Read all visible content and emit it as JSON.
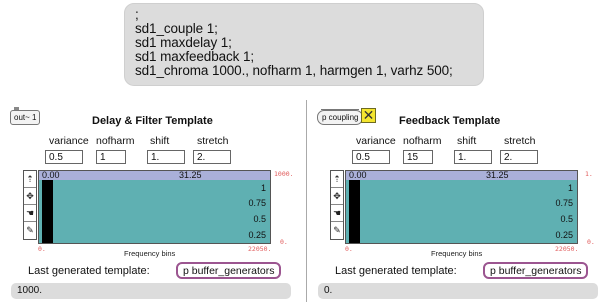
{
  "message_box": {
    "lines": [
      ";",
      "sd1_couple 1;",
      "sd1 maxdelay 1;",
      "sd1 maxfeedback 1;",
      "sd1_chroma 1000., nofharm 1, harmgen 1, varhz 500;"
    ]
  },
  "left_panel": {
    "out_label": "out~ 1",
    "title": "Delay & Filter Template",
    "params": [
      {
        "label": "variance",
        "value": "0.5"
      },
      {
        "label": "nofharm",
        "value": "1"
      },
      {
        "label": "shift",
        "value": "1."
      },
      {
        "label": "stretch",
        "value": "2."
      }
    ],
    "graph": {
      "head_left": "0.00",
      "head_mid": "31.25",
      "y_labels": [
        "1",
        "0.75",
        "0.5",
        "0.25"
      ],
      "range_top": "1000.",
      "range_bottom": "0.",
      "x_min": "0.",
      "x_max": "22050.",
      "x_label": "Frequency bins"
    },
    "last_label": "Last generated template:",
    "buffer_button": "p buffer_generators",
    "output_number": "1000."
  },
  "right_panel": {
    "coupling_label": "p coupling",
    "toggle_symbol": "✕",
    "title": "Feedback Template",
    "params": [
      {
        "label": "variance",
        "value": "0.5"
      },
      {
        "label": "nofharm",
        "value": "15"
      },
      {
        "label": "shift",
        "value": "1."
      },
      {
        "label": "stretch",
        "value": "2."
      }
    ],
    "graph": {
      "head_left": "0.00",
      "head_mid": "31.25",
      "y_labels": [
        "1",
        "0.75",
        "0.5",
        "0.25"
      ],
      "range_top": "1.",
      "range_bottom": "0.",
      "x_min": "0.",
      "x_max": "22050.",
      "x_label": "Frequency bins"
    },
    "last_label": "Last generated template:",
    "buffer_button": "p buffer_generators",
    "output_number": "0."
  },
  "tool_icons": [
    "pencil-arrow-icon",
    "move-icon",
    "hand-icon",
    "pencil-icon"
  ]
}
